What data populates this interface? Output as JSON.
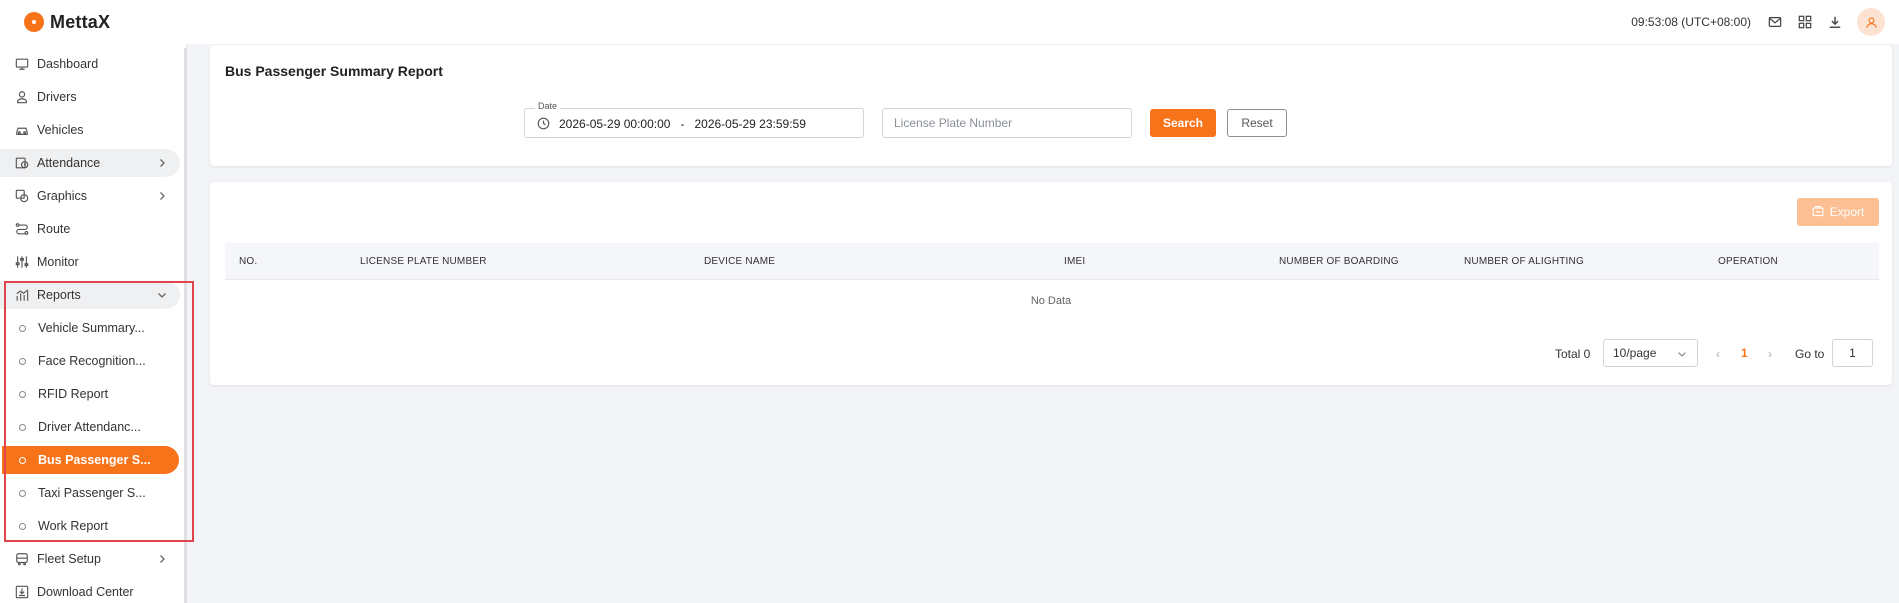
{
  "app": {
    "name": "MettaX"
  },
  "topbar": {
    "clock": "09:53:08 (UTC+08:00)",
    "icons": [
      "mail-icon",
      "apps-grid-icon",
      "download-icon",
      "user-avatar-icon"
    ]
  },
  "sidebar": {
    "items": [
      {
        "label": "Dashboard",
        "icon": "monitor-icon"
      },
      {
        "label": "Drivers",
        "icon": "person-icon"
      },
      {
        "label": "Vehicles",
        "icon": "car-icon"
      },
      {
        "label": "Attendance",
        "icon": "attendance-icon",
        "has_children": true
      },
      {
        "label": "Graphics",
        "icon": "graphics-icon",
        "has_children": true
      },
      {
        "label": "Route",
        "icon": "route-icon"
      },
      {
        "label": "Monitor",
        "icon": "sliders-icon"
      },
      {
        "label": "Reports",
        "icon": "chart-icon",
        "expanded": true
      },
      {
        "label": "Fleet Setup",
        "icon": "bus-icon",
        "has_children": true
      },
      {
        "label": "Download Center",
        "icon": "download-box-icon"
      }
    ],
    "reports_children": [
      {
        "label": "Vehicle Summary..."
      },
      {
        "label": "Face Recognition..."
      },
      {
        "label": "RFID Report"
      },
      {
        "label": "Driver Attendanc..."
      },
      {
        "label": "Bus Passenger S...",
        "active": true
      },
      {
        "label": "Taxi Passenger S..."
      },
      {
        "label": "Work Report"
      }
    ]
  },
  "filter": {
    "title": "Bus Passenger Summary Report",
    "date_label": "Date",
    "date_start": "2026-05-29 00:00:00",
    "date_separator": "-",
    "date_end": "2026-05-29 23:59:59",
    "plate_placeholder": "License Plate Number",
    "plate_value": "",
    "search_label": "Search",
    "reset_label": "Reset"
  },
  "table": {
    "export_label": "Export",
    "columns": [
      "NO.",
      "LICENSE PLATE NUMBER",
      "DEVICE NAME",
      "IMEI",
      "NUMBER OF BOARDING",
      "NUMBER OF ALIGHTING",
      "OPERATION"
    ],
    "rows": [],
    "empty_text": "No Data"
  },
  "pagination": {
    "total_text": "Total 0",
    "page_size": "10/page",
    "current_page": "1",
    "goto_label": "Go to",
    "goto_value": "1"
  },
  "colors": {
    "accent": "#f7731a",
    "accent_disabled": "#fbbf93",
    "highlight_border": "#e0444c"
  }
}
